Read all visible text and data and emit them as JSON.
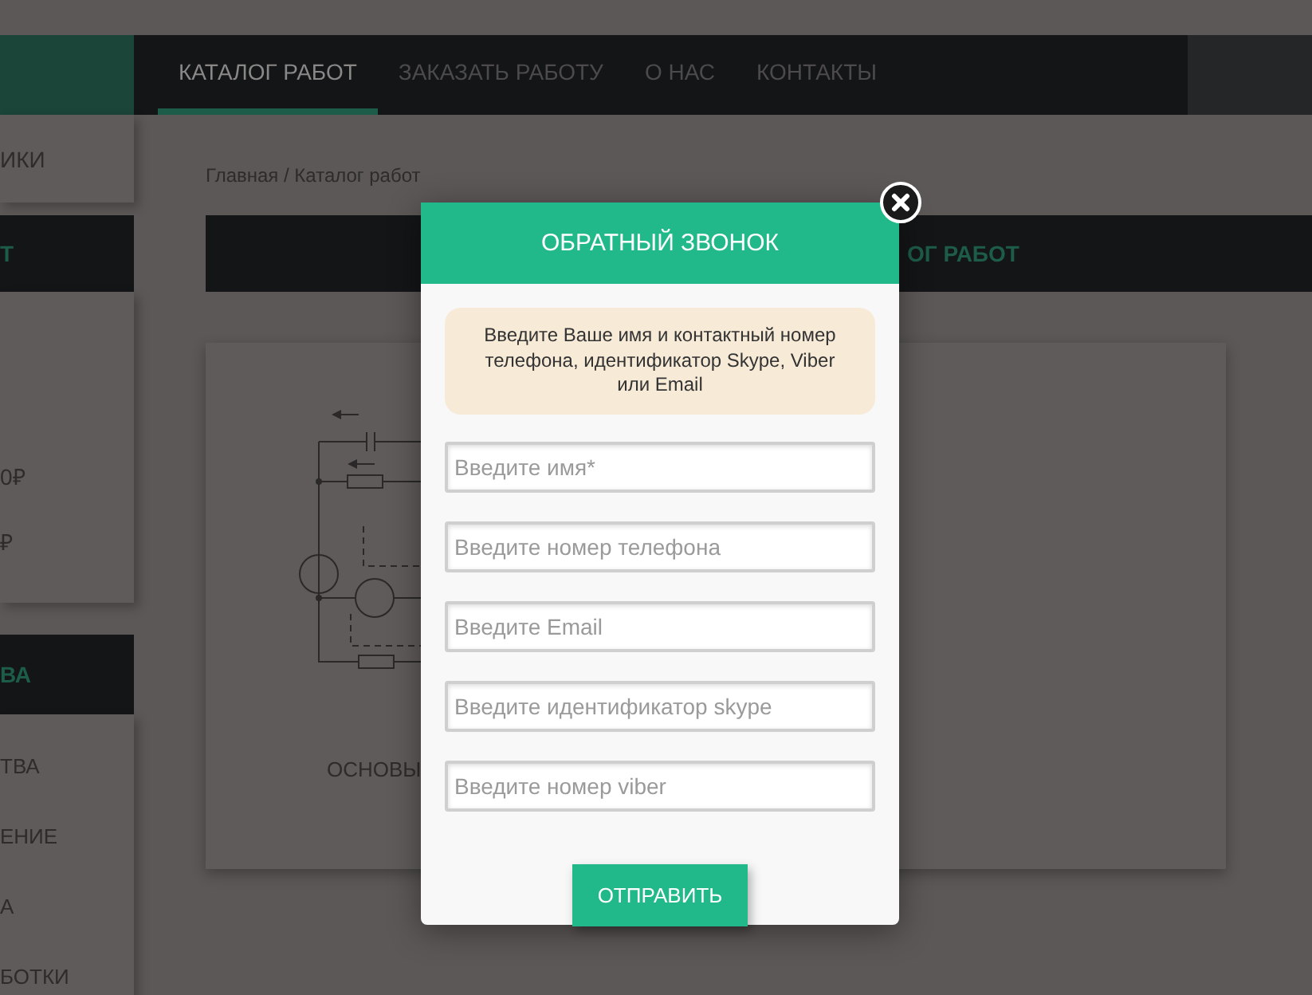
{
  "nav": {
    "items": [
      {
        "label": "КАТАЛОГ РАБОТ",
        "selected": true
      },
      {
        "label": "ЗАКАЗАТЬ РАБОТУ",
        "selected": false
      },
      {
        "label": "О НАС",
        "selected": false
      },
      {
        "label": "КОНТАКТЫ",
        "selected": false
      }
    ]
  },
  "sidebar": {
    "blocks": [
      {
        "kind": "card",
        "items": [
          "ИКИ"
        ]
      },
      {
        "kind": "header",
        "title": "Т"
      },
      {
        "kind": "card",
        "items": [
          "0₽",
          "₽"
        ]
      },
      {
        "kind": "header",
        "title": "ВА"
      },
      {
        "kind": "card",
        "items": [
          "ТВА",
          "ЕНИЕ",
          "А",
          "БОТКИ"
        ]
      }
    ]
  },
  "breadcrumb": "Главная / Каталог работ",
  "page_title": "ОГ РАБОТ",
  "card": {
    "caption": "ОСНОВЫ"
  },
  "modal": {
    "title": "ОБРАТНЫЙ ЗВОНОК",
    "info": "Введите Ваше имя и контактный номер телефона, идентификатор Skype, Viber или Email",
    "fields": [
      {
        "placeholder": "Введите имя*"
      },
      {
        "placeholder": "Введите номер телефона"
      },
      {
        "placeholder": "Введите Email"
      },
      {
        "placeholder": "Введите идентификатор skype"
      },
      {
        "placeholder": "Введите номер viber"
      }
    ],
    "submit": "ОТПРАВИТЬ"
  }
}
